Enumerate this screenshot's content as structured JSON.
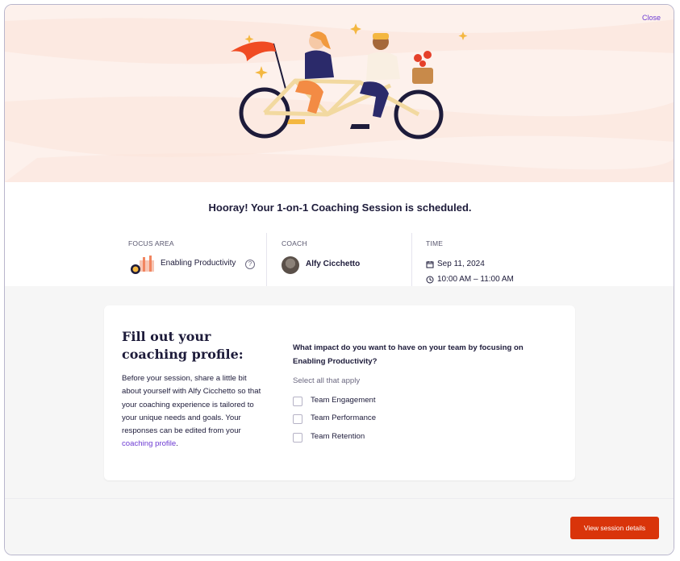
{
  "header": {
    "close_label": "Close"
  },
  "headline": "Hooray! Your 1-on-1 Coaching Session is scheduled.",
  "summary": {
    "focus": {
      "label": "FOCUS AREA",
      "value": "Enabling Productivity",
      "help_icon": "question-circle-icon"
    },
    "coach": {
      "label": "COACH",
      "name": "Alfy Cicchetto",
      "avatar_icon": "avatar-photo"
    },
    "time": {
      "label": "TIME",
      "date": "Sep 11, 2024",
      "range": "10:00 AM – 11:00 AM",
      "date_icon": "calendar-icon",
      "time_icon": "clock-icon"
    }
  },
  "profile": {
    "title": "Fill out your coaching profile:",
    "desc_text": "Before your session, share a little bit about yourself with Alfy Cicchetto so that your coaching experience is tailored to your unique needs and goals. Your responses can be edited from your ",
    "desc_link": "coaching profile",
    "desc_end": ".",
    "question": "What impact do you want to have on your team by focusing on Enabling Productivity?",
    "hint": "Select all that apply",
    "options": [
      "Team Engagement",
      "Team Performance",
      "Team Retention"
    ]
  },
  "footer": {
    "cta_label": "View session details"
  },
  "colors": {
    "accent": "#d9340a",
    "link": "#6d3bd3",
    "hero_bg": "#fdf1ec",
    "text": "#1d1b3a"
  }
}
